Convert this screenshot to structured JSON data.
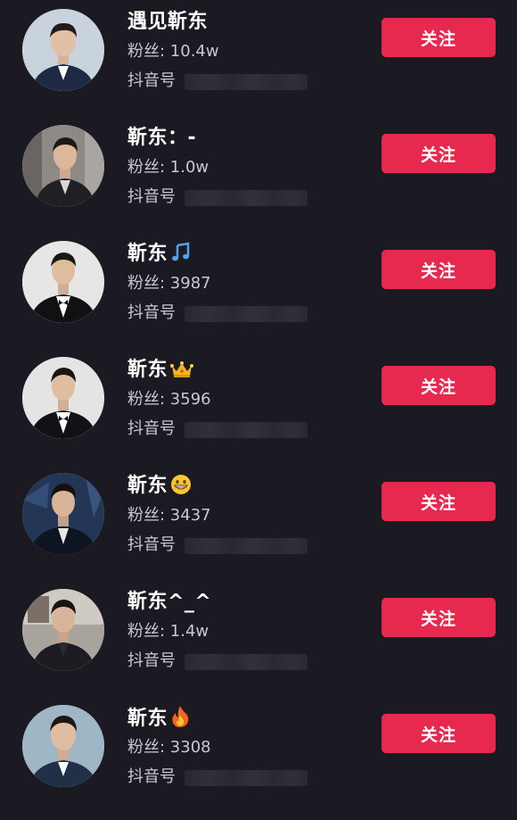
{
  "accounts": [
    {
      "name": "遇见靳东",
      "badge": "",
      "fans": "粉丝: 10.4w",
      "handle_label": "抖音号",
      "follow_label": "关注",
      "avatar_bg": "#c9d3de"
    },
    {
      "name": "靳东：-",
      "badge": "",
      "fans": "粉丝: 1.0w",
      "handle_label": "抖音号",
      "follow_label": "关注",
      "avatar_bg": "#8d8a86"
    },
    {
      "name": "靳东",
      "badge": "music-note-icon",
      "fans": "粉丝: 3987",
      "handle_label": "抖音号",
      "follow_label": "关注",
      "avatar_bg": "#e6e6e6"
    },
    {
      "name": "靳东",
      "badge": "crown-icon",
      "fans": "粉丝: 3596",
      "handle_label": "抖音号",
      "follow_label": "关注",
      "avatar_bg": "#e4e4e4"
    },
    {
      "name": "靳东",
      "badge": "grin-icon",
      "fans": "粉丝: 3437",
      "handle_label": "抖音号",
      "follow_label": "关注",
      "avatar_bg": "#243656"
    },
    {
      "name": "靳东^_^",
      "badge": "",
      "fans": "粉丝: 1.4w",
      "handle_label": "抖音号",
      "follow_label": "关注",
      "avatar_bg": "#a8a39c"
    },
    {
      "name": "靳东",
      "badge": "fire-icon",
      "fans": "粉丝: 3308",
      "handle_label": "抖音号",
      "follow_label": "关注",
      "avatar_bg": "#9fb6c6"
    }
  ],
  "colors": {
    "background": "#1b1a22",
    "follow_button": "#e8294f",
    "secondary_text": "#c9c8cf"
  }
}
